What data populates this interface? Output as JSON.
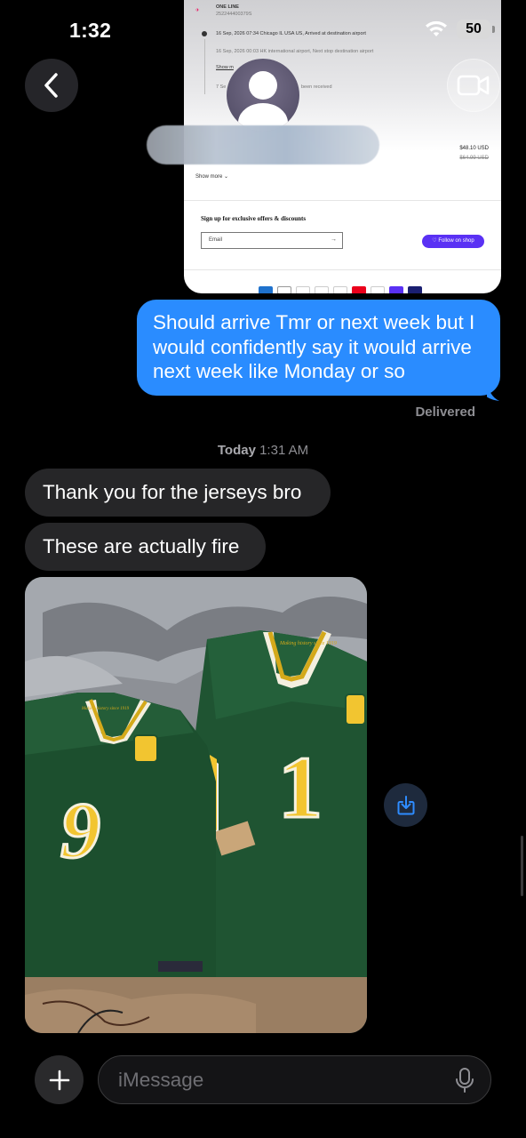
{
  "status_bar": {
    "time": "1:32",
    "battery": "50",
    "wifi_icon": "wifi-icon"
  },
  "header": {
    "back_icon": "chevron-left-icon",
    "video_icon": "video-camera-icon",
    "avatar_icon": "person-icon"
  },
  "shared_screenshot": {
    "carrier": "ONE LINE",
    "tracking": "252244400379S",
    "event1": "16 Sep, 2026 07:34   Chicago IL USA US, Arrived at destination airport",
    "event2": "16 Sep, 2026 00:03   HK international airport, Next stop destination airport",
    "show_more_1": "Show m",
    "event3": "7 Se",
    "event3_suffix": "been received",
    "price": "$48.10 USD",
    "price_old": "$64.99 USD",
    "show_more_2": "Show more ⌄",
    "signup_title": "Sign up for exclusive offers & discounts",
    "email_placeholder": "Email",
    "follow_label": "♡ Follow on shop"
  },
  "conversation": {
    "outgoing_message": "Should arrive Tmr or next week but I would confidently say it would arrive next week like Monday or so",
    "delivered_label": "Delivered",
    "timestamp_day": "Today",
    "timestamp_time": "1:31 AM",
    "incoming_messages": [
      "Thank you for the jerseys bro",
      "These are actually fire"
    ],
    "photo": {
      "jersey_left_number": "9",
      "jersey_right_number": "1",
      "collar_text": "Making history since 1919"
    },
    "save_icon": "download-icon"
  },
  "composer": {
    "plus_icon": "plus-icon",
    "placeholder": "iMessage",
    "mic_icon": "microphone-icon"
  }
}
